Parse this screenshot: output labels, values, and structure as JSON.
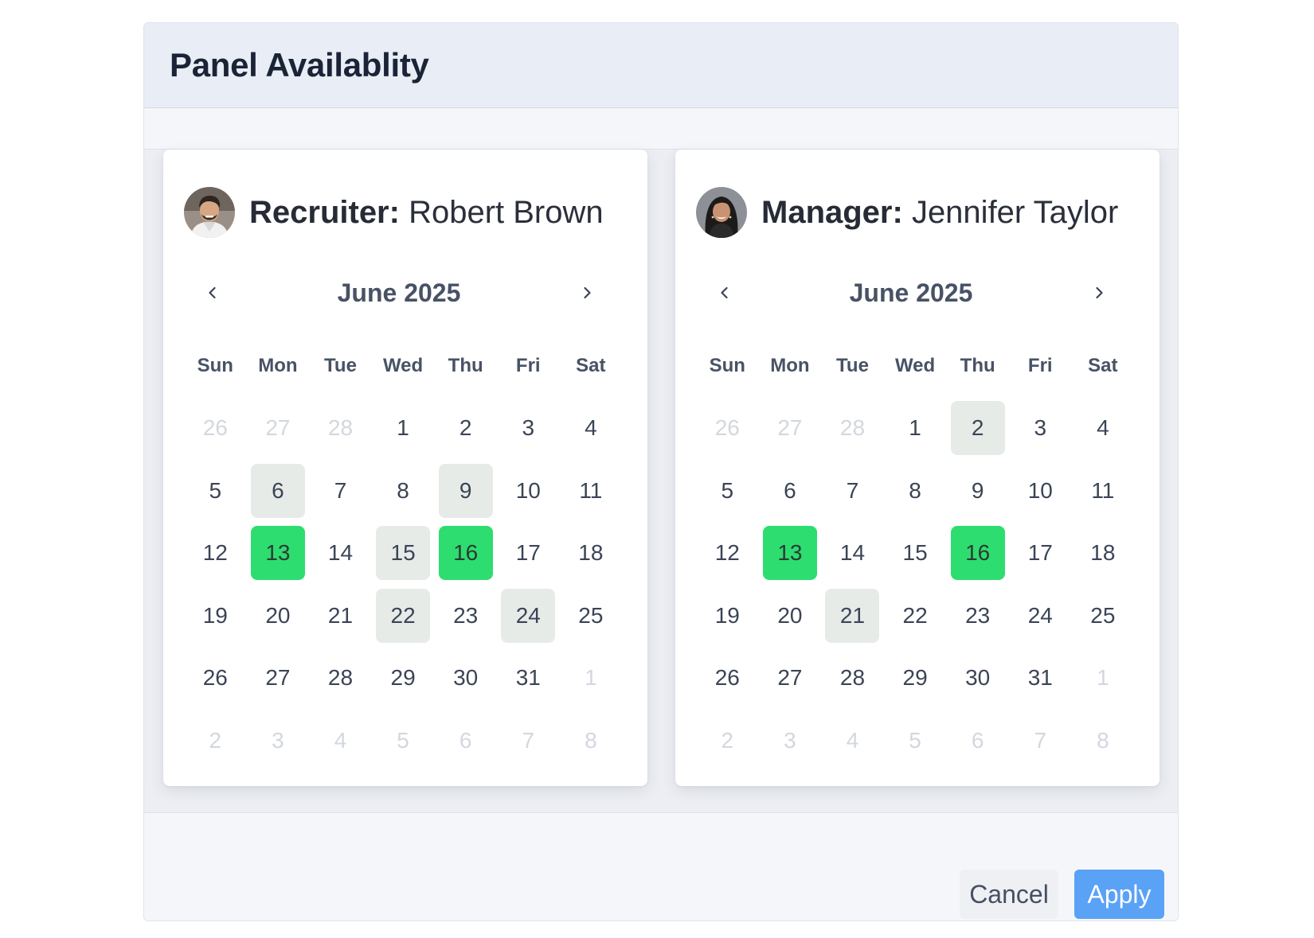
{
  "dialog": {
    "title": "Panel Availablity"
  },
  "calendars": [
    {
      "role": "Recruiter:",
      "name": "Robert Brown",
      "avatar": "man-avatar",
      "month": "June 2025",
      "weekdays": [
        "Sun",
        "Mon",
        "Tue",
        "Wed",
        "Thu",
        "Fri",
        "Sat"
      ],
      "days": [
        {
          "d": "26",
          "s": "muted"
        },
        {
          "d": "27",
          "s": "muted"
        },
        {
          "d": "28",
          "s": "muted"
        },
        {
          "d": "1",
          "s": ""
        },
        {
          "d": "2",
          "s": ""
        },
        {
          "d": "3",
          "s": ""
        },
        {
          "d": "4",
          "s": ""
        },
        {
          "d": "5",
          "s": ""
        },
        {
          "d": "6",
          "s": "partial"
        },
        {
          "d": "7",
          "s": ""
        },
        {
          "d": "8",
          "s": ""
        },
        {
          "d": "9",
          "s": "partial"
        },
        {
          "d": "10",
          "s": ""
        },
        {
          "d": "11",
          "s": ""
        },
        {
          "d": "12",
          "s": ""
        },
        {
          "d": "13",
          "s": "available"
        },
        {
          "d": "14",
          "s": ""
        },
        {
          "d": "15",
          "s": "partial"
        },
        {
          "d": "16",
          "s": "available"
        },
        {
          "d": "17",
          "s": ""
        },
        {
          "d": "18",
          "s": ""
        },
        {
          "d": "19",
          "s": ""
        },
        {
          "d": "20",
          "s": ""
        },
        {
          "d": "21",
          "s": ""
        },
        {
          "d": "22",
          "s": "partial"
        },
        {
          "d": "23",
          "s": ""
        },
        {
          "d": "24",
          "s": "partial"
        },
        {
          "d": "25",
          "s": ""
        },
        {
          "d": "26",
          "s": ""
        },
        {
          "d": "27",
          "s": ""
        },
        {
          "d": "28",
          "s": ""
        },
        {
          "d": "29",
          "s": ""
        },
        {
          "d": "30",
          "s": ""
        },
        {
          "d": "31",
          "s": ""
        },
        {
          "d": "1",
          "s": "muted"
        },
        {
          "d": "2",
          "s": "muted"
        },
        {
          "d": "3",
          "s": "muted"
        },
        {
          "d": "4",
          "s": "muted"
        },
        {
          "d": "5",
          "s": "muted"
        },
        {
          "d": "6",
          "s": "muted"
        },
        {
          "d": "7",
          "s": "muted"
        },
        {
          "d": "8",
          "s": "muted"
        }
      ]
    },
    {
      "role": "Manager:",
      "name": "Jennifer Taylor",
      "avatar": "woman-avatar",
      "month": "June 2025",
      "weekdays": [
        "Sun",
        "Mon",
        "Tue",
        "Wed",
        "Thu",
        "Fri",
        "Sat"
      ],
      "days": [
        {
          "d": "26",
          "s": "muted"
        },
        {
          "d": "27",
          "s": "muted"
        },
        {
          "d": "28",
          "s": "muted"
        },
        {
          "d": "1",
          "s": ""
        },
        {
          "d": "2",
          "s": "partial"
        },
        {
          "d": "3",
          "s": ""
        },
        {
          "d": "4",
          "s": ""
        },
        {
          "d": "5",
          "s": ""
        },
        {
          "d": "6",
          "s": ""
        },
        {
          "d": "7",
          "s": ""
        },
        {
          "d": "8",
          "s": ""
        },
        {
          "d": "9",
          "s": ""
        },
        {
          "d": "10",
          "s": ""
        },
        {
          "d": "11",
          "s": ""
        },
        {
          "d": "12",
          "s": ""
        },
        {
          "d": "13",
          "s": "available"
        },
        {
          "d": "14",
          "s": ""
        },
        {
          "d": "15",
          "s": ""
        },
        {
          "d": "16",
          "s": "available"
        },
        {
          "d": "17",
          "s": ""
        },
        {
          "d": "18",
          "s": ""
        },
        {
          "d": "19",
          "s": ""
        },
        {
          "d": "20",
          "s": ""
        },
        {
          "d": "21",
          "s": "partial"
        },
        {
          "d": "22",
          "s": ""
        },
        {
          "d": "23",
          "s": ""
        },
        {
          "d": "24",
          "s": ""
        },
        {
          "d": "25",
          "s": ""
        },
        {
          "d": "26",
          "s": ""
        },
        {
          "d": "27",
          "s": ""
        },
        {
          "d": "28",
          "s": ""
        },
        {
          "d": "29",
          "s": ""
        },
        {
          "d": "30",
          "s": ""
        },
        {
          "d": "31",
          "s": ""
        },
        {
          "d": "1",
          "s": "muted"
        },
        {
          "d": "2",
          "s": "muted"
        },
        {
          "d": "3",
          "s": "muted"
        },
        {
          "d": "4",
          "s": "muted"
        },
        {
          "d": "5",
          "s": "muted"
        },
        {
          "d": "6",
          "s": "muted"
        },
        {
          "d": "7",
          "s": "muted"
        },
        {
          "d": "8",
          "s": "muted"
        }
      ]
    }
  ],
  "footer": {
    "cancel_label": "Cancel",
    "apply_label": "Apply"
  },
  "colors": {
    "available": "#2ddd70",
    "partial": "#e6ebe8",
    "primary": "#5aa2f6",
    "header_bg": "#e8edf6"
  },
  "icons": {
    "prev": "chevron-left-icon",
    "next": "chevron-right-icon"
  }
}
